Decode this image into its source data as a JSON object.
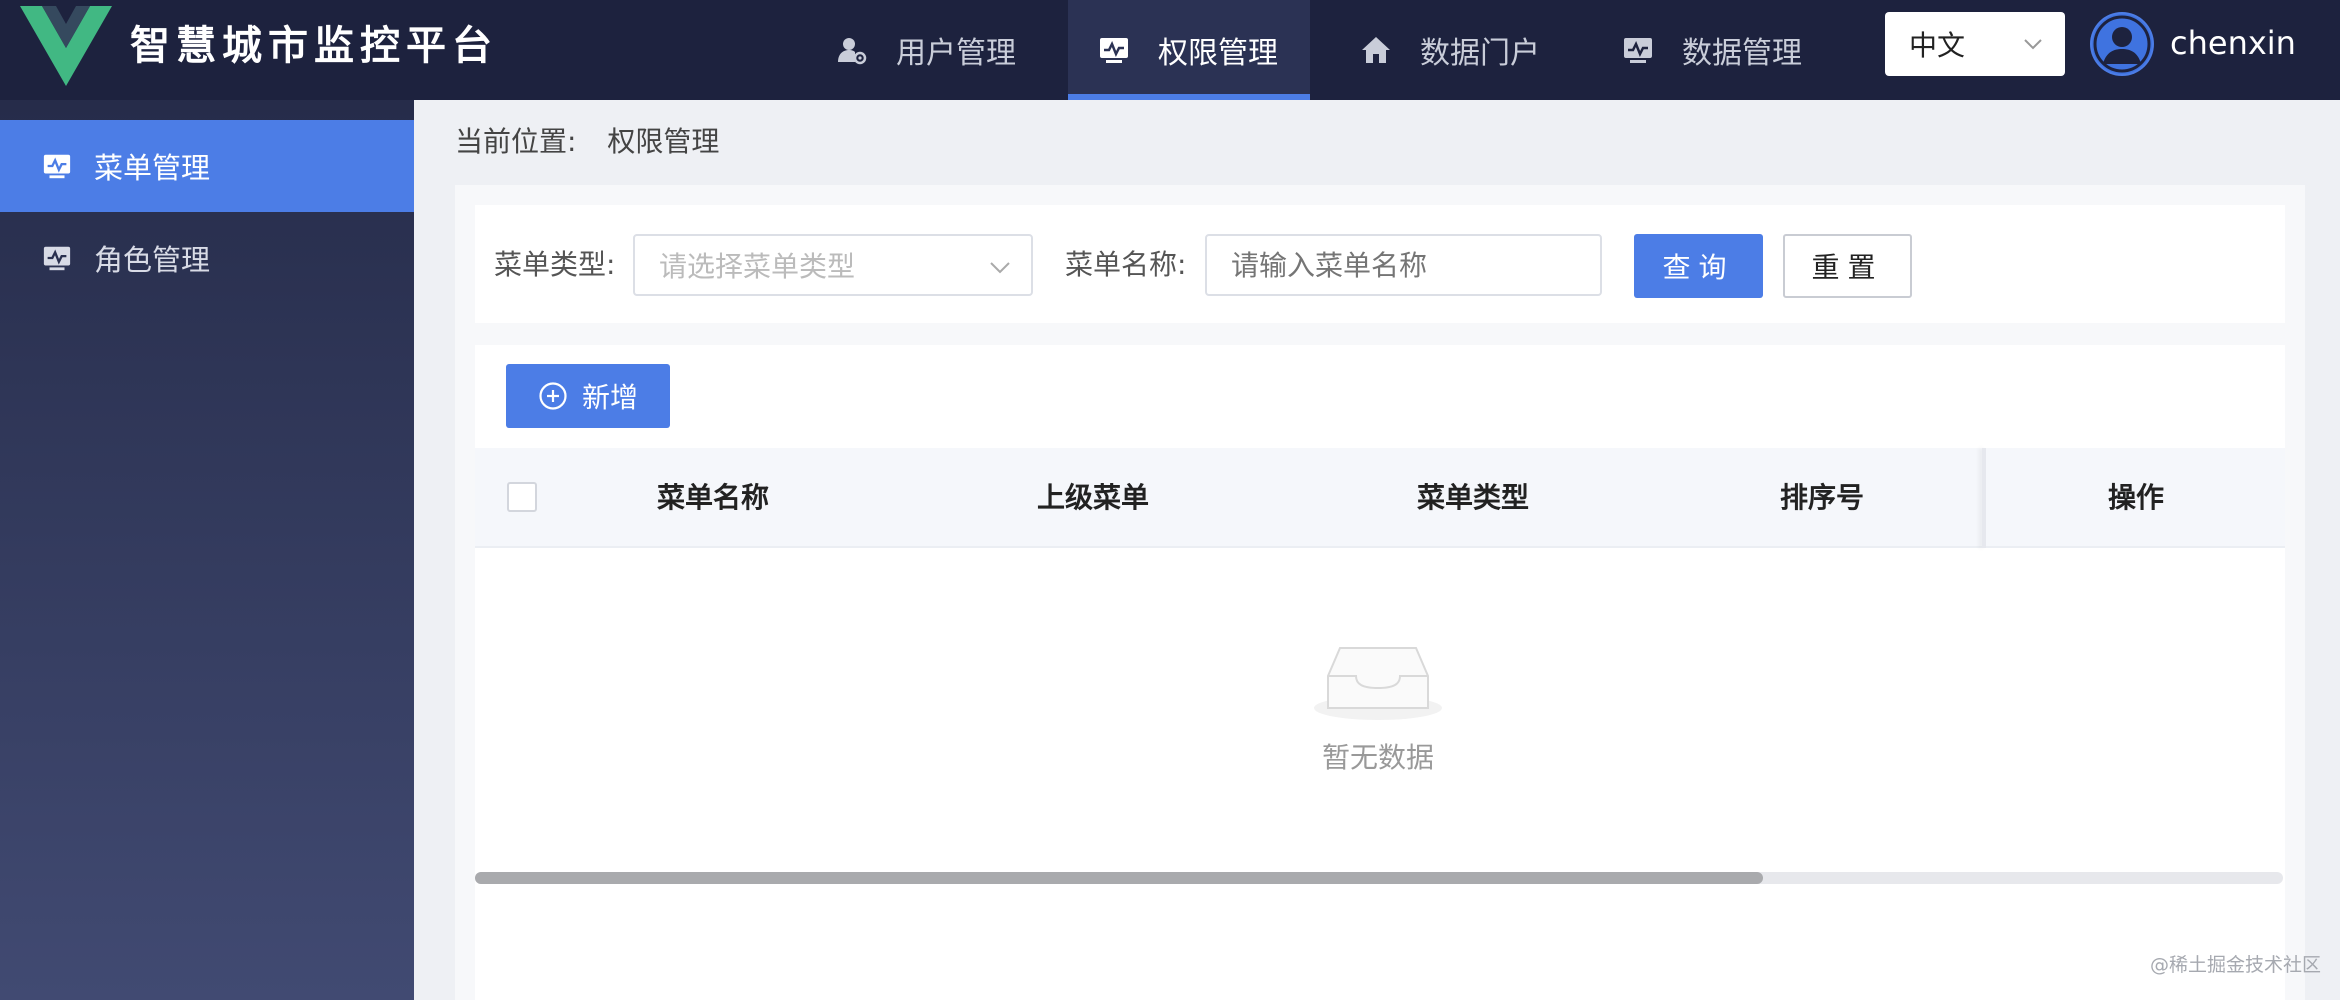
{
  "header": {
    "app_title": "智慧城市监控平台",
    "nav": [
      {
        "label": "用户管理",
        "icon": "user-settings-icon"
      },
      {
        "label": "权限管理",
        "icon": "monitor-icon",
        "active": true
      },
      {
        "label": "数据门户",
        "icon": "home-icon"
      },
      {
        "label": "数据管理",
        "icon": "monitor-icon"
      }
    ],
    "language": "中文",
    "username": "chenxin"
  },
  "sidebar": {
    "items": [
      {
        "label": "菜单管理",
        "icon": "monitor-icon",
        "active": true
      },
      {
        "label": "角色管理",
        "icon": "monitor-icon"
      }
    ]
  },
  "breadcrumb": {
    "prefix": "当前位置:",
    "current": "权限管理"
  },
  "search": {
    "type_label": "菜单类型:",
    "type_placeholder": "请选择菜单类型",
    "name_label": "菜单名称:",
    "name_placeholder": "请输入菜单名称",
    "query_button": "查询",
    "reset_button": "重置"
  },
  "toolbar": {
    "add_button": "新增"
  },
  "table": {
    "columns": [
      "菜单名称",
      "上级菜单",
      "菜单类型",
      "排序号",
      "操作"
    ],
    "rows": [],
    "empty_text": "暂无数据"
  },
  "watermark": "@稀土掘金技术社区",
  "colors": {
    "primary": "#4c7de6",
    "header_bg": "#1d223e",
    "sidebar_top": "#262c4a",
    "sidebar_bottom": "#414a72",
    "logo_green": "#41b883",
    "logo_dark": "#35495e"
  }
}
